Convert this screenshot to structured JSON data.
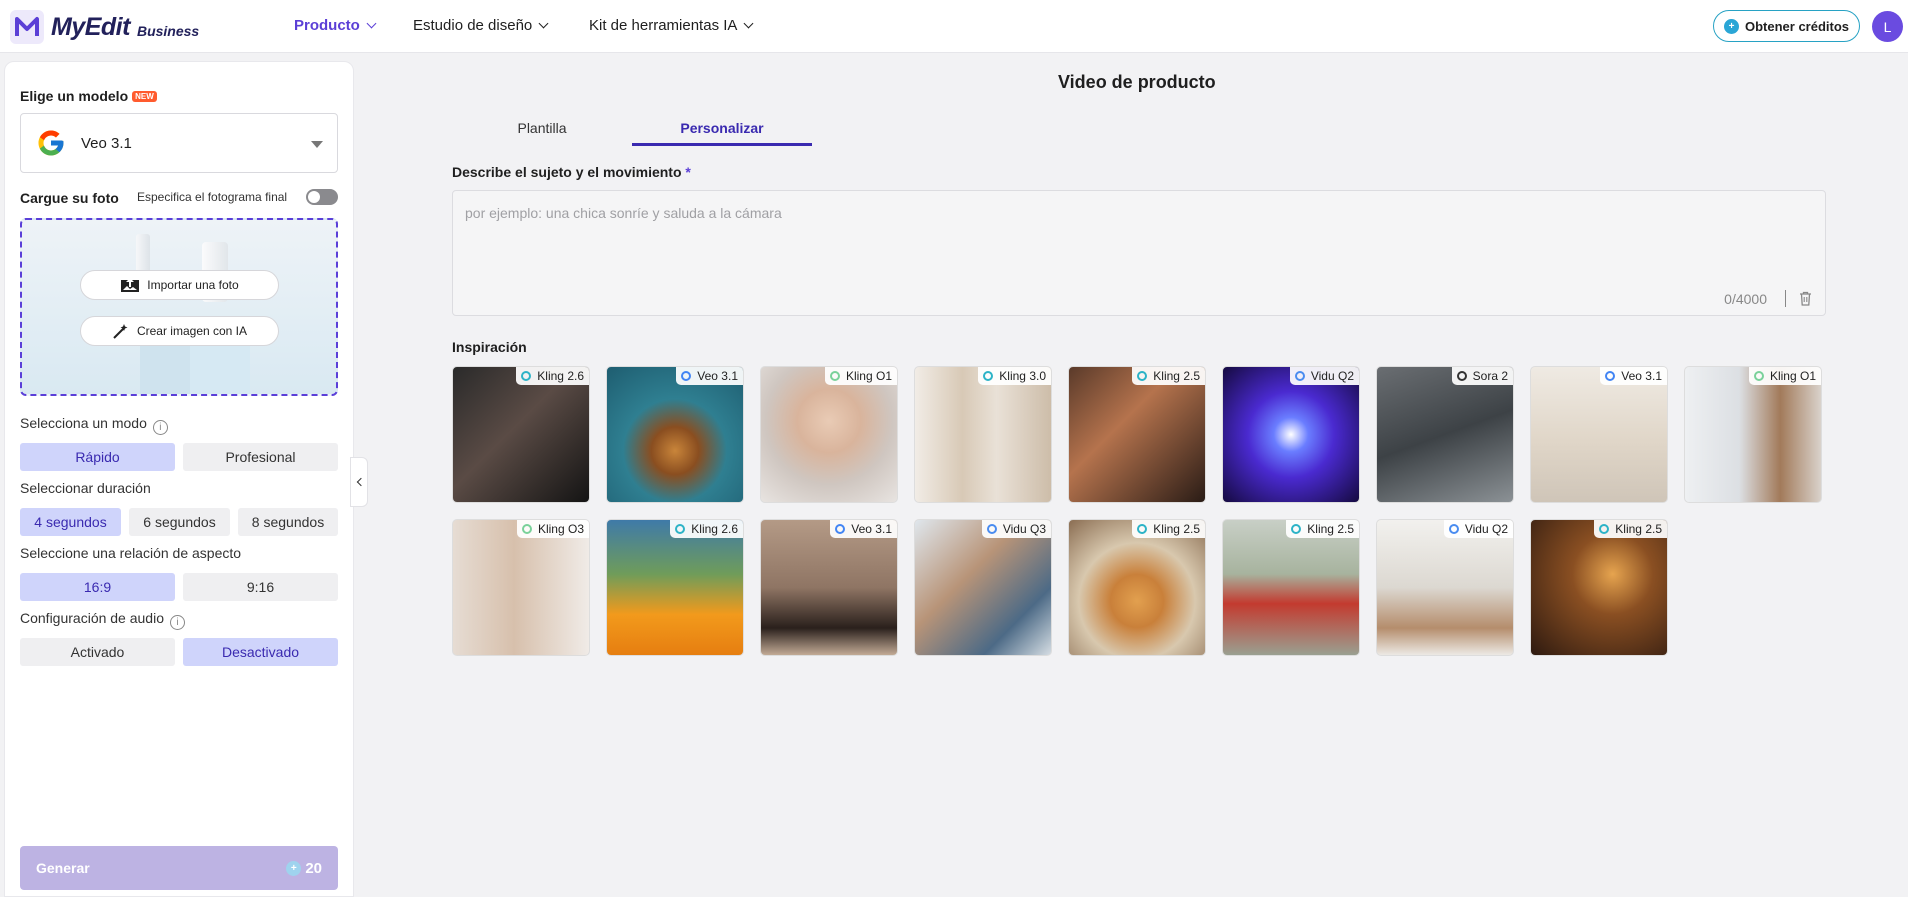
{
  "header": {
    "brand": "MyEdit",
    "brand_sub": "Business",
    "nav": [
      {
        "label": "Producto",
        "active": true
      },
      {
        "label": "Estudio de diseño",
        "active": false
      },
      {
        "label": "Kit de herramientas IA",
        "active": false
      }
    ],
    "credits_label": "Obtener créditos",
    "avatar_letter": "L"
  },
  "sidebar": {
    "model_label": "Elige un modelo",
    "new_badge": "NEW",
    "model_value": "Veo 3.1",
    "upload_label": "Cargue su foto",
    "final_frame_label": "Especifica el fotograma final",
    "final_frame_on": false,
    "import_button": "Importar una foto",
    "create_ai_button": "Crear imagen con IA",
    "mode_label": "Selecciona un modo",
    "modes": [
      {
        "label": "Rápido",
        "selected": true
      },
      {
        "label": "Profesional",
        "selected": false
      }
    ],
    "duration_label": "Seleccionar duración",
    "durations": [
      {
        "label": "4 segundos",
        "selected": true
      },
      {
        "label": "6 segundos",
        "selected": false
      },
      {
        "label": "8 segundos",
        "selected": false
      }
    ],
    "aspect_label": "Seleccione una relación de aspecto",
    "aspects": [
      {
        "label": "16:9",
        "selected": true
      },
      {
        "label": "9:16",
        "selected": false
      }
    ],
    "audio_label": "Configuración de audio",
    "audio_options": [
      {
        "label": "Activado",
        "selected": false
      },
      {
        "label": "Desactivado",
        "selected": true
      }
    ],
    "generate_label": "Generar",
    "generate_cost": "20"
  },
  "main": {
    "title": "Video de producto",
    "tabs": [
      {
        "label": "Plantilla",
        "active": false
      },
      {
        "label": "Personalizar",
        "active": true
      }
    ],
    "prompt_label": "Describe el sujeto y el movimiento",
    "required_mark": "*",
    "prompt_placeholder": "por ejemplo: una chica sonríe y saluda a la cámara",
    "prompt_value": "",
    "counter": "0/4000",
    "inspiration_label": "Inspiración",
    "inspiration": [
      {
        "model": "Kling 2.6",
        "icon": "kling-icon",
        "scene": "couple-sunglasses"
      },
      {
        "model": "Veo 3.1",
        "icon": "google-icon",
        "scene": "burger-underwater"
      },
      {
        "model": "Kling O1",
        "icon": "kling-o-icon",
        "scene": "portrait-woman"
      },
      {
        "model": "Kling 3.0",
        "icon": "kling-icon",
        "scene": "dress-mannequin"
      },
      {
        "model": "Kling 2.5",
        "icon": "kling-icon",
        "scene": "phone-ad"
      },
      {
        "model": "Vidu Q2",
        "icon": "vidu-icon",
        "scene": "energy-can"
      },
      {
        "model": "Sora 2",
        "icon": "sora-icon",
        "scene": "running-shoe"
      },
      {
        "model": "Veo 3.1",
        "icon": "google-icon",
        "scene": "serum-bottle"
      },
      {
        "model": "Kling O1",
        "icon": "kling-o-icon",
        "scene": "woman-lotion"
      },
      {
        "model": "Kling O3",
        "icon": "kling-o-icon",
        "scene": "skincare-face"
      },
      {
        "model": "Kling 2.6",
        "icon": "kling-icon",
        "scene": "orange-juice"
      },
      {
        "model": "Veo 3.1",
        "icon": "google-icon",
        "scene": "black-dress"
      },
      {
        "model": "Vidu Q3",
        "icon": "vidu-icon",
        "scene": "man-drinking"
      },
      {
        "model": "Kling 2.5",
        "icon": "kling-icon",
        "scene": "pancakes"
      },
      {
        "model": "Kling 2.5",
        "icon": "kling-icon",
        "scene": "strawberries"
      },
      {
        "model": "Vidu Q2",
        "icon": "vidu-icon",
        "scene": "kitchen-couple"
      },
      {
        "model": "Kling 2.5",
        "icon": "kling-icon",
        "scene": "japanese-room"
      }
    ]
  },
  "colors": {
    "accent": "#5b3fd6",
    "selected_bg": "#cfd4fb",
    "credits_border": "#27a2c4",
    "generate_disabled": "#bdb3e3"
  }
}
